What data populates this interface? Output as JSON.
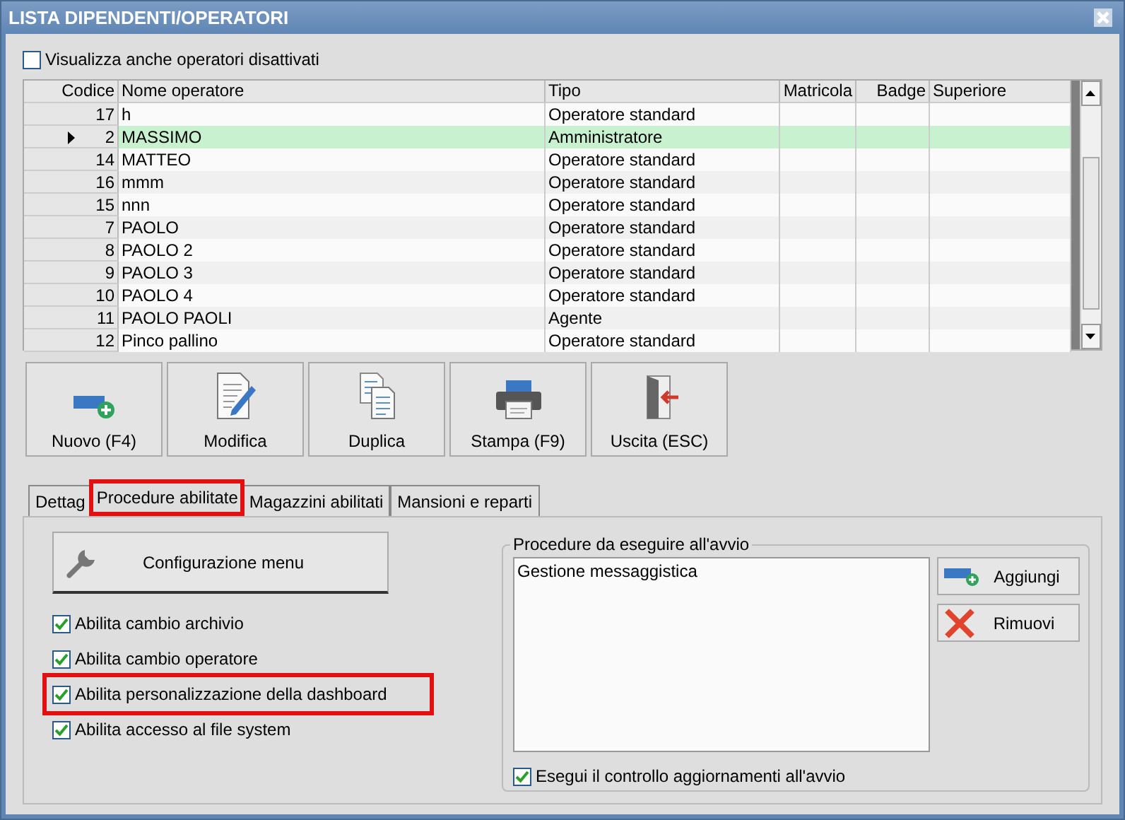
{
  "window": {
    "title": "LISTA DIPENDENTI/OPERATORI"
  },
  "show_disabled": {
    "label": "Visualizza anche operatori disattivati",
    "checked": false
  },
  "table": {
    "columns": [
      "Codice",
      "Nome operatore",
      "Tipo",
      "Matricola",
      "Badge",
      "Superiore"
    ],
    "rows": [
      {
        "codice": "17",
        "nome": "h",
        "tipo": "Operatore standard",
        "selected": false
      },
      {
        "codice": "2",
        "nome": "MASSIMO",
        "tipo": "Amministratore",
        "selected": true
      },
      {
        "codice": "14",
        "nome": "MATTEO",
        "tipo": "Operatore standard",
        "selected": false
      },
      {
        "codice": "16",
        "nome": "mmm",
        "tipo": "Operatore standard",
        "selected": false
      },
      {
        "codice": "15",
        "nome": "nnn",
        "tipo": "Operatore standard",
        "selected": false
      },
      {
        "codice": "7",
        "nome": "PAOLO",
        "tipo": "Operatore standard",
        "selected": false
      },
      {
        "codice": "8",
        "nome": "PAOLO 2",
        "tipo": "Operatore standard",
        "selected": false
      },
      {
        "codice": "9",
        "nome": "PAOLO 3",
        "tipo": "Operatore standard",
        "selected": false
      },
      {
        "codice": "10",
        "nome": "PAOLO 4",
        "tipo": "Operatore standard",
        "selected": false
      },
      {
        "codice": "11",
        "nome": "PAOLO PAOLI",
        "tipo": "Agente",
        "selected": false
      },
      {
        "codice": "12",
        "nome": "Pinco pallino",
        "tipo": "Operatore standard",
        "selected": false
      }
    ]
  },
  "toolbar": [
    {
      "kind": "new",
      "label": "Nuovo (F4)"
    },
    {
      "kind": "edit",
      "label": "Modifica"
    },
    {
      "kind": "duplicate",
      "label": "Duplica"
    },
    {
      "kind": "print",
      "label": "Stampa (F9)"
    },
    {
      "kind": "exit",
      "label": "Uscita (ESC)"
    }
  ],
  "tabs": [
    {
      "label": "Dettag",
      "selected": false,
      "highlighted": false
    },
    {
      "label": "Procedure abilitate",
      "selected": true,
      "highlighted": true
    },
    {
      "label": "Magazzini abilitati",
      "selected": false,
      "highlighted": false
    },
    {
      "label": "Mansioni e reparti",
      "selected": false,
      "highlighted": false
    }
  ],
  "config_button": {
    "label": "Configurazione menu"
  },
  "options": [
    {
      "label": "Abilita cambio archivio",
      "checked": true,
      "highlighted": false
    },
    {
      "label": "Abilita cambio operatore",
      "checked": true,
      "highlighted": false
    },
    {
      "label": "Abilita personalizzazione della dashboard",
      "checked": true,
      "highlighted": true
    },
    {
      "label": "Abilita accesso al file system",
      "checked": true,
      "highlighted": false
    }
  ],
  "startup": {
    "title": "Procedure da eseguire all'avvio",
    "items": [
      "Gestione messaggistica"
    ],
    "buttons": [
      {
        "kind": "add",
        "label": "Aggiungi"
      },
      {
        "kind": "remove",
        "label": "Rimuovi"
      }
    ],
    "check": {
      "label": "Esegui il controllo aggiornamenti all'avvio",
      "checked": true
    }
  }
}
